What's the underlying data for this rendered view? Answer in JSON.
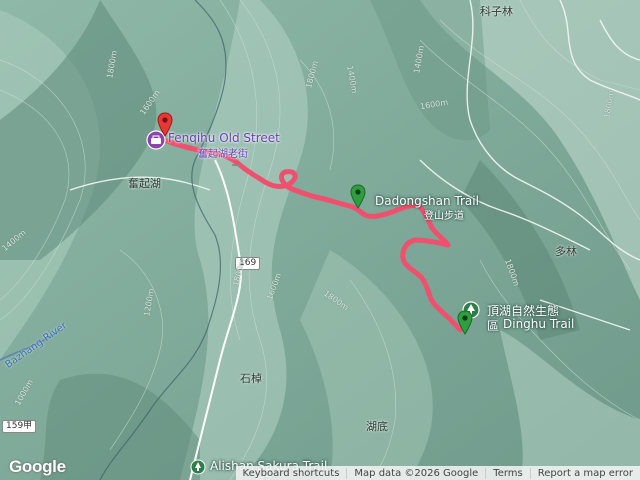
{
  "map": {
    "places": {
      "kezilin": "科子林",
      "fenqihu_zh": "奮起湖",
      "duolin": "多林",
      "shizhuo": "石棹",
      "hudi": "湖底",
      "dinghu_zh": "頂湖自然生態",
      "dinghu_en_prefix": "區",
      "dinghu_en": "Dinghu Trail",
      "dadong_en": "Dadongshan Trail",
      "dadong_zh": "登山步道",
      "fenqihu_street_en": "Fenqihu Old Street",
      "fenqihu_street_zh": "奮起湖老街",
      "alishan_sakura": "Alishan Sakura Trail",
      "alishan_sakura_zh": "櫻之",
      "bazhang_river": "Bazhang River"
    },
    "roads": {
      "r169": "169",
      "r159": "159甲"
    },
    "contours": {
      "c1800a": "1800m",
      "c1600a": "1600m",
      "c1800b": "1800m",
      "c1400a": "1400m",
      "c1400b": "1400m",
      "c1600b": "1600m",
      "c1800c": "1800m",
      "c1800d": "1800m",
      "c1400c": "1400m",
      "c1200": "1200m",
      "c1800e": "1800m",
      "c1600c": "1600m",
      "c1800f": "1800m",
      "c1000": "1000m"
    },
    "colors": {
      "track": "#f0506e",
      "start_pin": "#e53935",
      "end_pin": "#2e9e3e",
      "poi_purple": "#8e44ad"
    }
  },
  "footer": {
    "logo": "Google",
    "keyboard": "Keyboard shortcuts",
    "map_data": "Map data ©2026 Google",
    "terms": "Terms",
    "report": "Report a map error"
  }
}
